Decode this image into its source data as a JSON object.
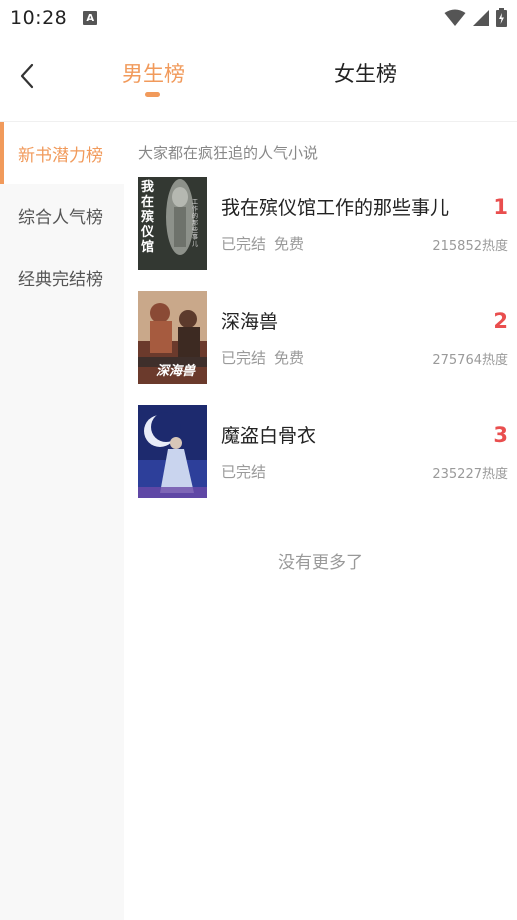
{
  "status_bar": {
    "time": "10:28",
    "notification_icon": "a-notification-icon"
  },
  "header": {
    "back_icon": "back-arrow-icon",
    "tabs": [
      {
        "label": "男生榜",
        "active": true
      },
      {
        "label": "女生榜",
        "active": false
      }
    ]
  },
  "sidebar": {
    "items": [
      {
        "label": "新书潜力榜",
        "active": true
      },
      {
        "label": "综合人气榜",
        "active": false
      },
      {
        "label": "经典完结榜",
        "active": false
      }
    ]
  },
  "content": {
    "subtitle": "大家都在疯狂追的人气小说",
    "books": [
      {
        "title": "我在殡仪馆工作的那些事儿",
        "status": "已完结",
        "price": "免费",
        "rank": "1",
        "heat": "215852热度",
        "cover_text": "我在殡仪馆",
        "cover_subtext": "工作的那些事儿"
      },
      {
        "title": "深海兽",
        "status": "已完结",
        "price": "免费",
        "rank": "2",
        "heat": "275764热度",
        "cover_text": "深海兽"
      },
      {
        "title": "魔盗白骨衣",
        "status": "已完结",
        "price": "",
        "rank": "3",
        "heat": "235227热度"
      }
    ],
    "no_more": "没有更多了"
  },
  "colors": {
    "accent": "#f19a5b",
    "rank": "#e94e4e",
    "sidebar_bg": "#f8f8f8"
  }
}
